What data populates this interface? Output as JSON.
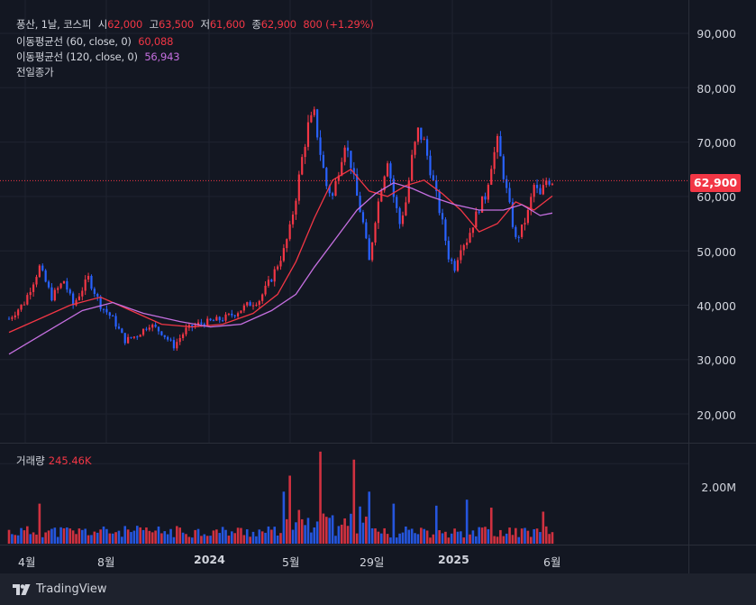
{
  "legend": {
    "symbol": "풍산, 1날, 코스피",
    "open_label": "시",
    "open": "62,000",
    "high_label": "고",
    "high": "63,500",
    "low_label": "저",
    "low": "61,600",
    "close_label": "종",
    "close": "62,900",
    "change": "800 (+1.29%)",
    "ma60_label": "이동평균선 (60, close, 0)",
    "ma60_value": "60,088",
    "ma120_label": "이동평균선 (120, close, 0)",
    "ma120_value": "56,943",
    "prev_close_label": "전일종가"
  },
  "volume_legend": {
    "label": "거래량",
    "value": "245.46K"
  },
  "price_axis": {
    "ticks": [
      "90,000",
      "80,000",
      "70,000",
      "60,000",
      "50,000",
      "40,000",
      "30,000",
      "20,000"
    ],
    "last_price": "62,900"
  },
  "volume_axis": {
    "ticks": [
      "2.00M"
    ]
  },
  "time_axis": {
    "labels": [
      "4월",
      "8월",
      "2024",
      "5월",
      "29일",
      "2025",
      "6월"
    ]
  },
  "footer": {
    "brand": "TradingView"
  },
  "colors": {
    "up": "#f23645",
    "down": "#2962ff",
    "ma60": "#f23645",
    "ma120": "#c56fe0",
    "background": "#131722",
    "grid": "#1f2330"
  },
  "chart_data": {
    "type": "line",
    "title": "풍산, 1날, 코스피",
    "ylim": [
      15000,
      95000
    ],
    "series": [
      {
        "name": "close",
        "points": [
          [
            0,
            37500
          ],
          [
            5,
            40500
          ],
          [
            10,
            47000
          ],
          [
            14,
            41500
          ],
          [
            18,
            44500
          ],
          [
            21,
            40000
          ],
          [
            26,
            45000
          ],
          [
            30,
            40000
          ],
          [
            34,
            37500
          ],
          [
            38,
            33500
          ],
          [
            42,
            34500
          ],
          [
            46,
            36500
          ],
          [
            50,
            35000
          ],
          [
            54,
            32500
          ],
          [
            58,
            35500
          ],
          [
            62,
            36500
          ],
          [
            66,
            37000
          ],
          [
            70,
            37500
          ],
          [
            74,
            38500
          ],
          [
            78,
            40000
          ],
          [
            82,
            41000
          ],
          [
            86,
            45000
          ],
          [
            90,
            50000
          ],
          [
            92,
            54000
          ],
          [
            94,
            60000
          ],
          [
            96,
            67000
          ],
          [
            98,
            73000
          ],
          [
            100,
            75000
          ],
          [
            102,
            68000
          ],
          [
            104,
            62000
          ],
          [
            106,
            60000
          ],
          [
            108,
            65000
          ],
          [
            110,
            70000
          ],
          [
            112,
            66000
          ],
          [
            114,
            60000
          ],
          [
            116,
            55000
          ],
          [
            118,
            48000
          ],
          [
            120,
            56000
          ],
          [
            122,
            62000
          ],
          [
            124,
            67000
          ],
          [
            126,
            60000
          ],
          [
            128,
            55000
          ],
          [
            130,
            59000
          ],
          [
            132,
            67000
          ],
          [
            134,
            72000
          ],
          [
            136,
            70000
          ],
          [
            138,
            65000
          ],
          [
            140,
            60000
          ],
          [
            142,
            55000
          ],
          [
            144,
            49000
          ],
          [
            146,
            47000
          ],
          [
            148,
            51000
          ],
          [
            150,
            52000
          ],
          [
            152,
            55000
          ],
          [
            154,
            58000
          ],
          [
            156,
            60000
          ],
          [
            158,
            66000
          ],
          [
            160,
            70000
          ],
          [
            162,
            64000
          ],
          [
            164,
            58000
          ],
          [
            166,
            52000
          ],
          [
            168,
            54000
          ],
          [
            170,
            57000
          ],
          [
            172,
            62000
          ],
          [
            174,
            60000
          ],
          [
            176,
            63000
          ],
          [
            178,
            62900
          ]
        ]
      },
      {
        "name": "이동평균선 (60, close, 0)",
        "points": [
          [
            0,
            35000
          ],
          [
            10,
            37500
          ],
          [
            20,
            40000
          ],
          [
            30,
            41500
          ],
          [
            40,
            39000
          ],
          [
            50,
            36500
          ],
          [
            60,
            36000
          ],
          [
            70,
            36500
          ],
          [
            80,
            38500
          ],
          [
            88,
            42000
          ],
          [
            94,
            48000
          ],
          [
            100,
            56000
          ],
          [
            106,
            63000
          ],
          [
            112,
            65000
          ],
          [
            118,
            61000
          ],
          [
            124,
            60000
          ],
          [
            130,
            62000
          ],
          [
            136,
            63000
          ],
          [
            142,
            60500
          ],
          [
            148,
            57500
          ],
          [
            154,
            53500
          ],
          [
            160,
            55000
          ],
          [
            166,
            59000
          ],
          [
            172,
            57500
          ],
          [
            178,
            60088
          ]
        ]
      },
      {
        "name": "이동평균선 (120, close, 0)",
        "points": [
          [
            0,
            31000
          ],
          [
            12,
            35000
          ],
          [
            24,
            39000
          ],
          [
            34,
            40500
          ],
          [
            44,
            38500
          ],
          [
            56,
            37000
          ],
          [
            66,
            36000
          ],
          [
            76,
            36500
          ],
          [
            86,
            39000
          ],
          [
            94,
            42000
          ],
          [
            100,
            47000
          ],
          [
            108,
            53000
          ],
          [
            114,
            57500
          ],
          [
            120,
            60500
          ],
          [
            126,
            62500
          ],
          [
            132,
            61500
          ],
          [
            138,
            60000
          ],
          [
            146,
            58500
          ],
          [
            154,
            57500
          ],
          [
            162,
            57500
          ],
          [
            168,
            58500
          ],
          [
            174,
            56500
          ],
          [
            178,
            56943
          ]
        ]
      }
    ],
    "x_labels": [
      "4월",
      "8월",
      "2024",
      "5월",
      "29일",
      "2025",
      "6월"
    ],
    "last_price": 62900,
    "volume_max": 2500000
  }
}
